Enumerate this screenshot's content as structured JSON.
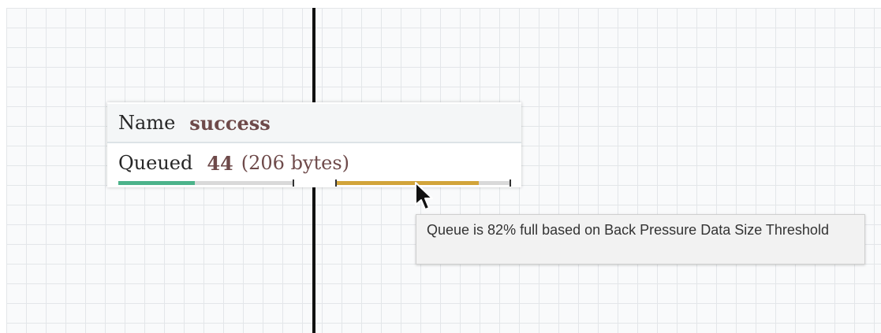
{
  "connection": {
    "name_label": "Name",
    "name_value": "success",
    "queued_label": "Queued",
    "queued_count": "44",
    "queued_size": "(206 bytes)",
    "object_threshold_fill_percent": 44,
    "data_size_threshold_fill_percent": 82,
    "object_bar_color": "#4cb38a",
    "data_size_bar_color": "#d2a43a"
  },
  "tooltip": {
    "text": "Queue is 82% full based on Back Pressure Data Size Threshold"
  },
  "icons": {
    "cursor": "mouse-pointer-icon"
  }
}
